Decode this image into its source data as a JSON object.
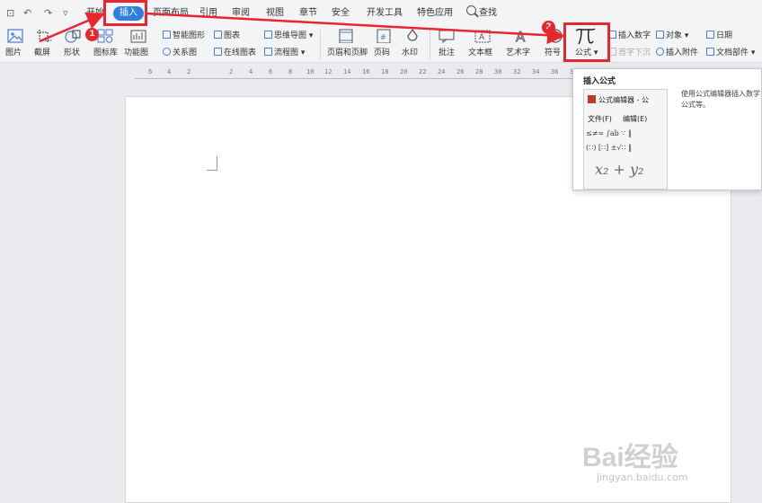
{
  "quick_access": [
    "⊡",
    "↶",
    "↷",
    "▿"
  ],
  "menu_tabs": [
    "开始",
    "插入",
    "页面布局",
    "引用",
    "审阅",
    "视图",
    "章节",
    "安全",
    "开发工具",
    "特色应用",
    "查找"
  ],
  "ribbon": {
    "picture": "图片",
    "screenshot": "截屏",
    "shape": "形状",
    "icon_library": "图标库",
    "function_chart": "功能图",
    "smart_shape": "智能图形",
    "relation_chart": "关系图",
    "chart": "图表",
    "online_chart": "在线图表",
    "mind_map": "思维导图",
    "flowchart": "流程图",
    "header_footer": "页眉和页脚",
    "page_number": "页码",
    "watermark": "水印",
    "comment": "批注",
    "text_box": "文本框",
    "word_art": "艺术字",
    "symbol": "符号",
    "formula": "公式",
    "insert_number": "插入数字",
    "drop_cap": "首字下沉",
    "object": "对象",
    "attachment": "插入附件",
    "date": "日期",
    "doc_part": "文档部件"
  },
  "ruler_labels": [
    "6",
    "4",
    "2",
    "2",
    "4",
    "6",
    "8",
    "10",
    "12",
    "14",
    "16",
    "18",
    "20",
    "22",
    "24",
    "26",
    "28",
    "30",
    "32",
    "34",
    "36",
    "38"
  ],
  "tooltip": {
    "title": "插入公式",
    "description": "使用公式编辑器插入数学公式等。",
    "preview_title": "公式编辑器 - 公",
    "preview_menu": [
      "文件(F)",
      "编辑(E)"
    ],
    "preview_symbols_row1": "≤≠≈  ∫ab ∵  ‖",
    "preview_symbols_row2": "(∷) [∷]  ±√∷  ‖",
    "preview_formula": "x₂ + y₂"
  },
  "badges": [
    "1",
    "2"
  ],
  "watermark": {
    "brand": "Bai经验",
    "url": "jingyan.baidu.com"
  },
  "colors": {
    "highlight": "#e8262d",
    "active_tab": "#2d7fe0"
  }
}
